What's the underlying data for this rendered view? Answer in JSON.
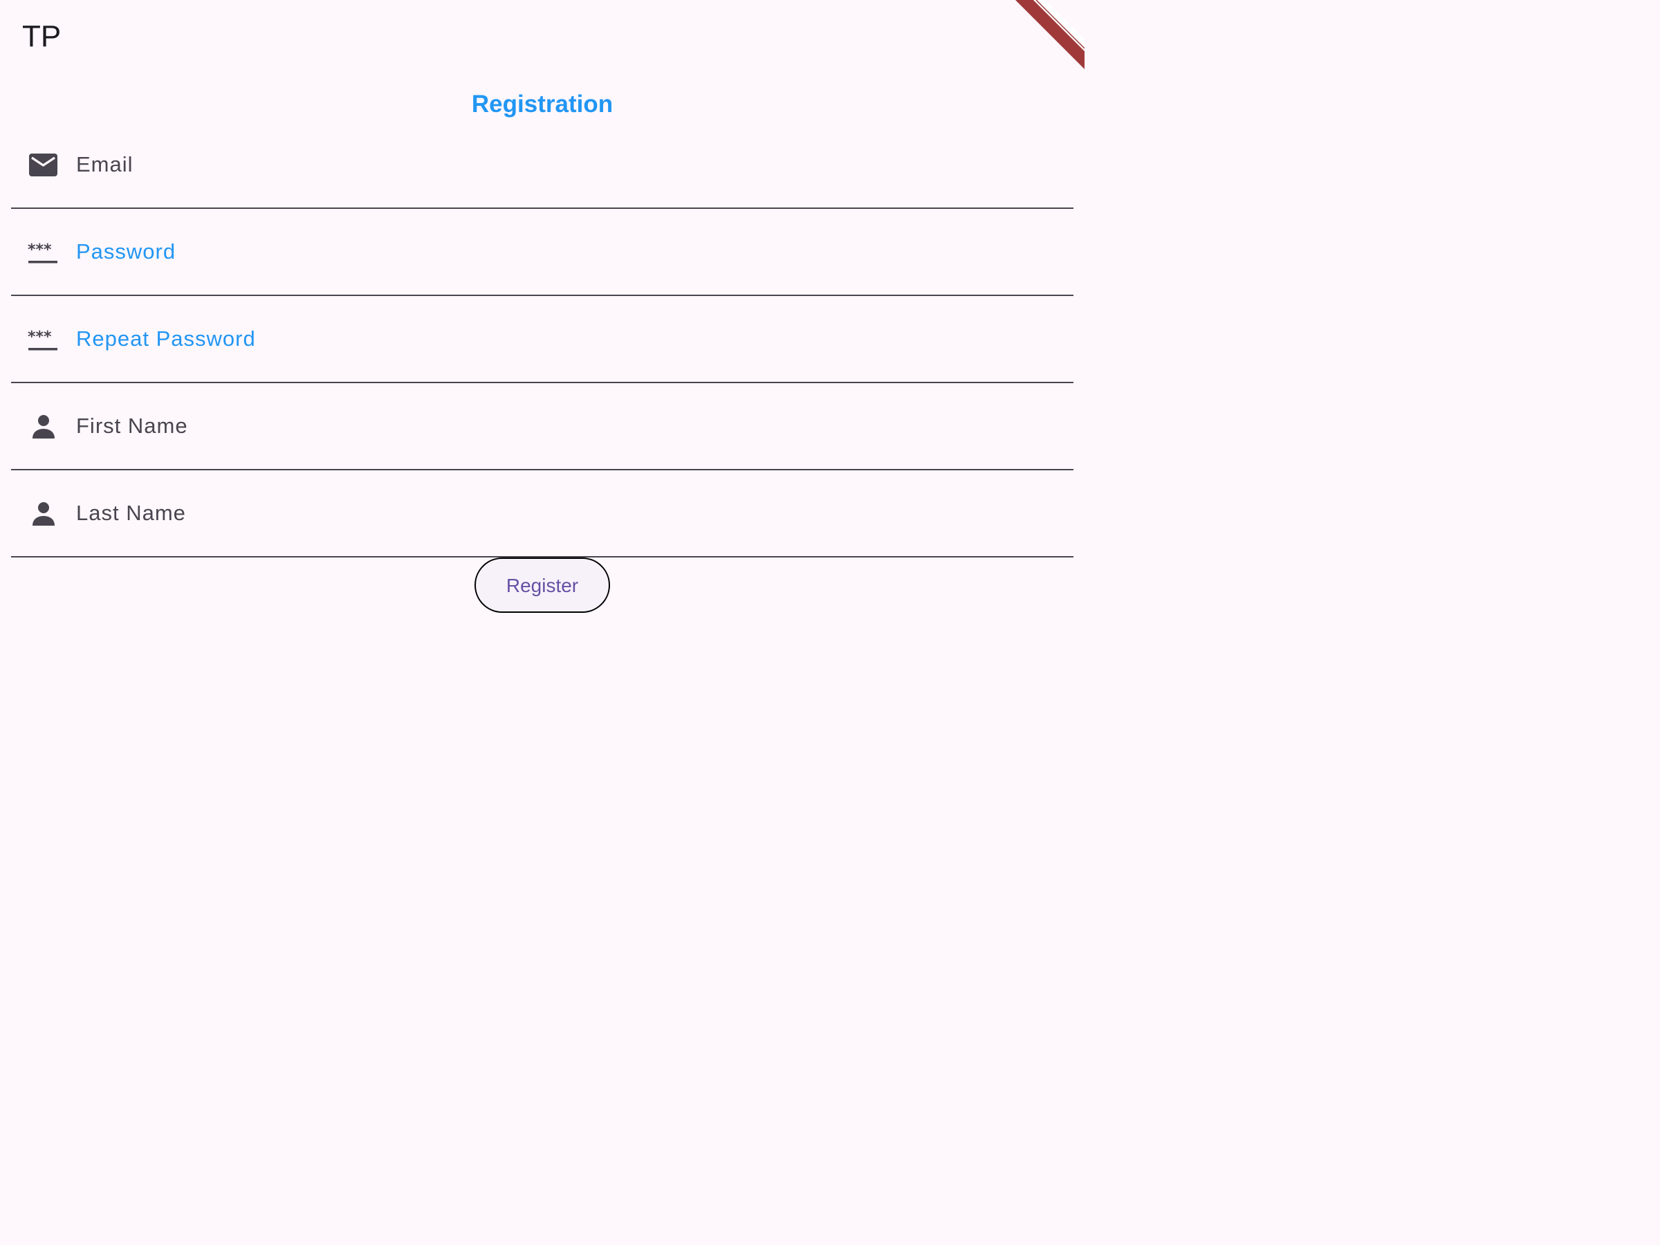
{
  "app_bar": {
    "title": "TP"
  },
  "form": {
    "title": "Registration",
    "fields": [
      {
        "name": "email",
        "label": "Email",
        "icon": "email-icon",
        "value": ""
      },
      {
        "name": "password",
        "label": "Password",
        "icon": "password-icon",
        "value": ""
      },
      {
        "name": "repeat-password",
        "label": "Repeat Password",
        "icon": "password-icon",
        "value": ""
      },
      {
        "name": "first-name",
        "label": "First Name",
        "icon": "person-icon",
        "value": ""
      },
      {
        "name": "last-name",
        "label": "Last Name",
        "icon": "person-icon",
        "value": ""
      }
    ],
    "register_label": "Register"
  },
  "colors": {
    "background": "#fef7fc",
    "accent": "#2196f3",
    "icon": "#49454f",
    "button_text": "#6750a4",
    "debug_banner": "#a03a3a"
  }
}
